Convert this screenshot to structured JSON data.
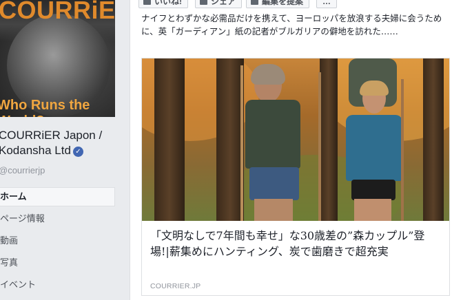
{
  "sidebar": {
    "cover": {
      "logo_text": "COURRiER",
      "tagline": "Who Runs the World?"
    },
    "page_name": "COURRiER Japon / Kodansha Ltd",
    "handle": "@courrierjp",
    "nav": [
      {
        "label": "ホーム",
        "active": true
      },
      {
        "label": "ページ情報",
        "active": false
      },
      {
        "label": "動画",
        "active": false
      },
      {
        "label": "写真",
        "active": false
      },
      {
        "label": "イベント",
        "active": false
      }
    ]
  },
  "post": {
    "actions": {
      "like_label": "いいね!",
      "share_label": "シェア",
      "suggest_edit_label": "編集を提案",
      "more_label": "…"
    },
    "text": "ナイフとわずかな必需品だけを携えて、ヨーロッパを放浪する夫婦に会うために、英「ガーディアン」紙の記者がブルガリアの僻地を訪れた……",
    "link": {
      "title": "「文明なしで7年間も幸せ」な30歳差の”森カップル”登場!|薪集めにハンティング、炭で歯磨きで超充実",
      "source": "COURRIER.JP"
    }
  },
  "colors": {
    "brand_orange": "#e08a2c",
    "verified_blue": "#4267b2",
    "sidebar_bg": "#e9ebee"
  }
}
